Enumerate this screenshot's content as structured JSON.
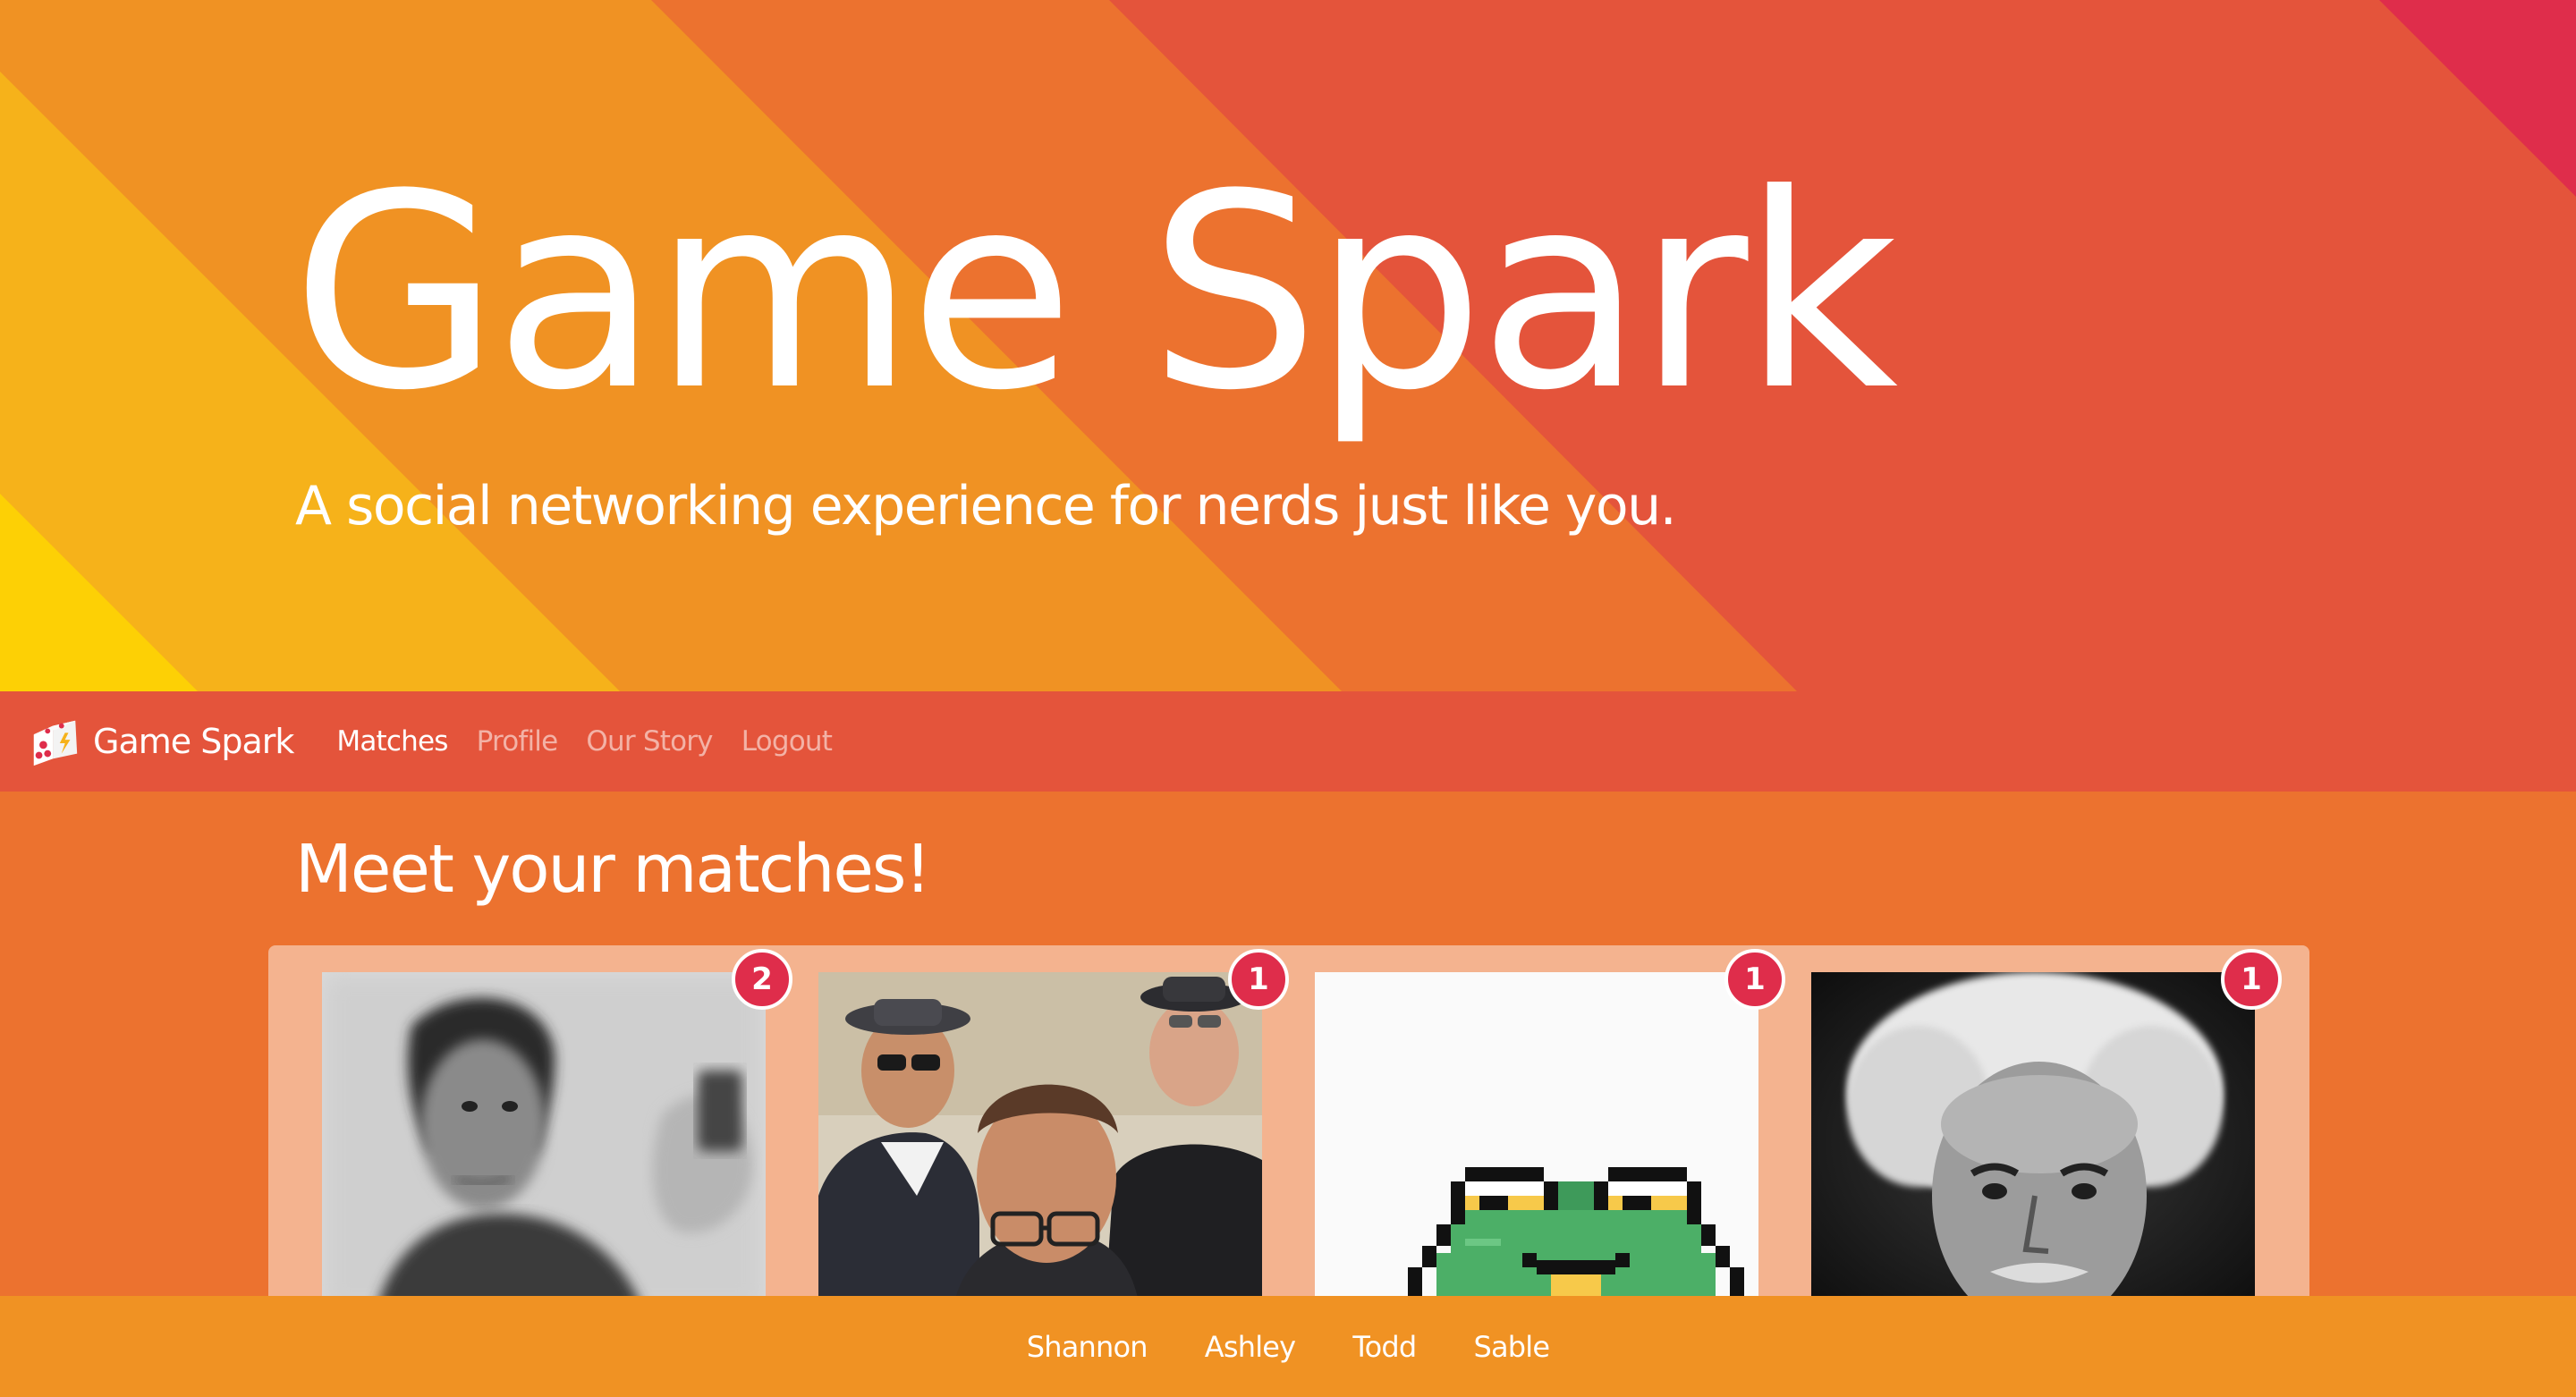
{
  "hero": {
    "title": "Game Spark",
    "tagline": "A social networking experience for nerds just like you."
  },
  "navbar": {
    "brand": "Game Spark",
    "brand_icon": "dice-icon",
    "links": [
      {
        "label": "Matches",
        "active": true
      },
      {
        "label": "Profile",
        "active": false
      },
      {
        "label": "Our Story",
        "active": false
      },
      {
        "label": "Logout",
        "active": false
      }
    ]
  },
  "matches": {
    "heading": "Meet your matches!",
    "cards": [
      {
        "badge": "2",
        "photo": "blurred-man-portrait"
      },
      {
        "badge": "1",
        "photo": "group-of-men-with-sunglasses"
      },
      {
        "badge": "1",
        "photo": "pixel-art-frog"
      },
      {
        "badge": "1",
        "photo": "einstein-portrait"
      }
    ]
  },
  "footer": {
    "names": [
      "Shannon",
      "Ashley",
      "Todd",
      "Sable"
    ]
  },
  "colors": {
    "hero_red": "#e4543b",
    "stripe_orange": "#ec722f",
    "stripe_amber": "#f09223",
    "stripe_yellow_orange": "#f6b21a",
    "stripe_yellow": "#fdd005",
    "corner_crimson": "#df2d4b",
    "panel_peach": "#f4b38f",
    "badge": "#df2d4b"
  }
}
